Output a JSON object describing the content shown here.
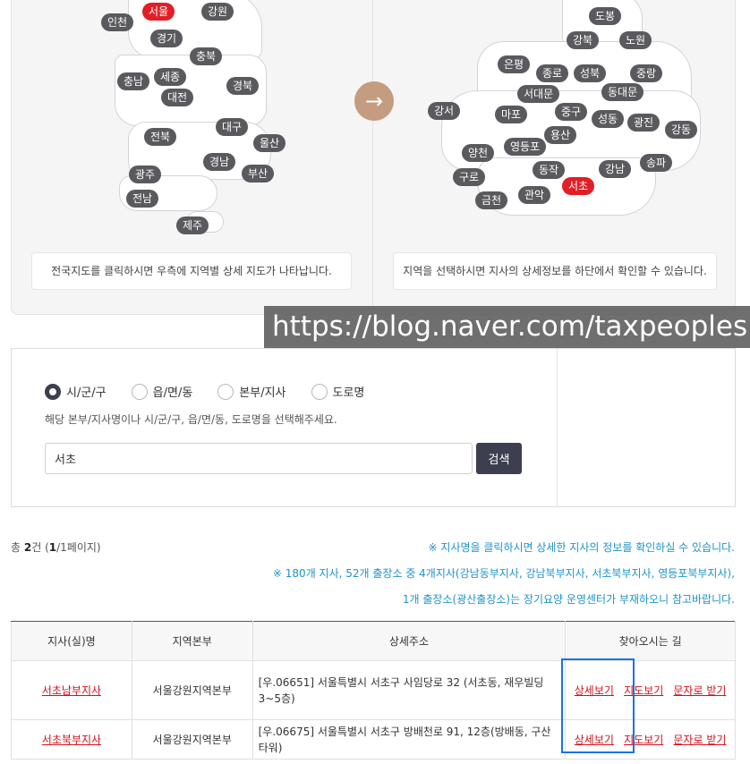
{
  "map": {
    "arrow_icon": "→",
    "left_hint": "전국지도를 클릭하시면 우측에 지역별 상세 지도가 나타납니다.",
    "right_hint": "지역을 선택하시면 지사의 상세정보를 하단에서 확인할 수 있습니다.",
    "korea_regions": [
      "서울",
      "강원",
      "인천",
      "경기",
      "충북",
      "충남",
      "세종",
      "대전",
      "경북",
      "전북",
      "대구",
      "울산",
      "경남",
      "부산",
      "광주",
      "전남",
      "제주"
    ],
    "seoul_districts": [
      "도봉",
      "강북",
      "노원",
      "은평",
      "종로",
      "성북",
      "중랑",
      "서대문",
      "동대문",
      "강서",
      "마포",
      "중구",
      "성동",
      "광진",
      "강동",
      "용산",
      "양천",
      "영등포",
      "구로",
      "동작",
      "강남",
      "송파",
      "서초",
      "금천",
      "관악"
    ],
    "active_region": "서울",
    "active_district": "서초"
  },
  "watermark": "https://blog.naver.com/taxpeoples",
  "search": {
    "options": [
      "시/군/구",
      "읍/면/동",
      "본부/지사",
      "도로명"
    ],
    "selected_option": "시/군/구",
    "help": "해당 본부/지사명이나 시/군/구, 읍/면/동, 도로명을 선택해주세요.",
    "input_value": "서초",
    "button_label": "검색"
  },
  "results": {
    "count_prefix": "총 ",
    "count": "2",
    "count_unit": "건 (",
    "page": "1",
    "page_suffix": "/1페이지)",
    "notices": [
      "※ 지사명을 클릭하시면 상세한 지사의 정보를 확인하실 수 있습니다.",
      "※ 180개 지사, 52개 출장소 중 4개지사(강남동부지사, 강남북부지사, 서초북부지사, 영등포북부지사),",
      "1개 출장소(광산출장소)는 장기요양 운영센터가 부재하오니 참고바랍니다."
    ]
  },
  "table": {
    "headers": [
      "지사(실)명",
      "지역본부",
      "상세주소",
      "찾아오시는 길"
    ],
    "rows": [
      {
        "name": "서초남부지사",
        "hq": "서울강원지역본부",
        "address": "[우.06651] 서울특별시 서초구 사임당로 32 (서초동, 재우빌딩 3~5층)",
        "links": [
          "상세보기",
          "지도보기",
          "문자로 받기"
        ]
      },
      {
        "name": "서초북부지사",
        "hq": "서울강원지역본부",
        "address": "[우.06675] 서울특별시 서초구 방배천로 91, 12층(방배동, 구산타워)",
        "links": [
          "상세보기",
          "지도보기",
          "문자로 받기"
        ]
      }
    ]
  },
  "colors": {
    "accent_dark": "#3d3f50",
    "active_red": "#e01f26",
    "notice_blue": "#1f93c8",
    "highlight_blue": "#1a73e8",
    "arrow_tan": "#c49c7f"
  }
}
